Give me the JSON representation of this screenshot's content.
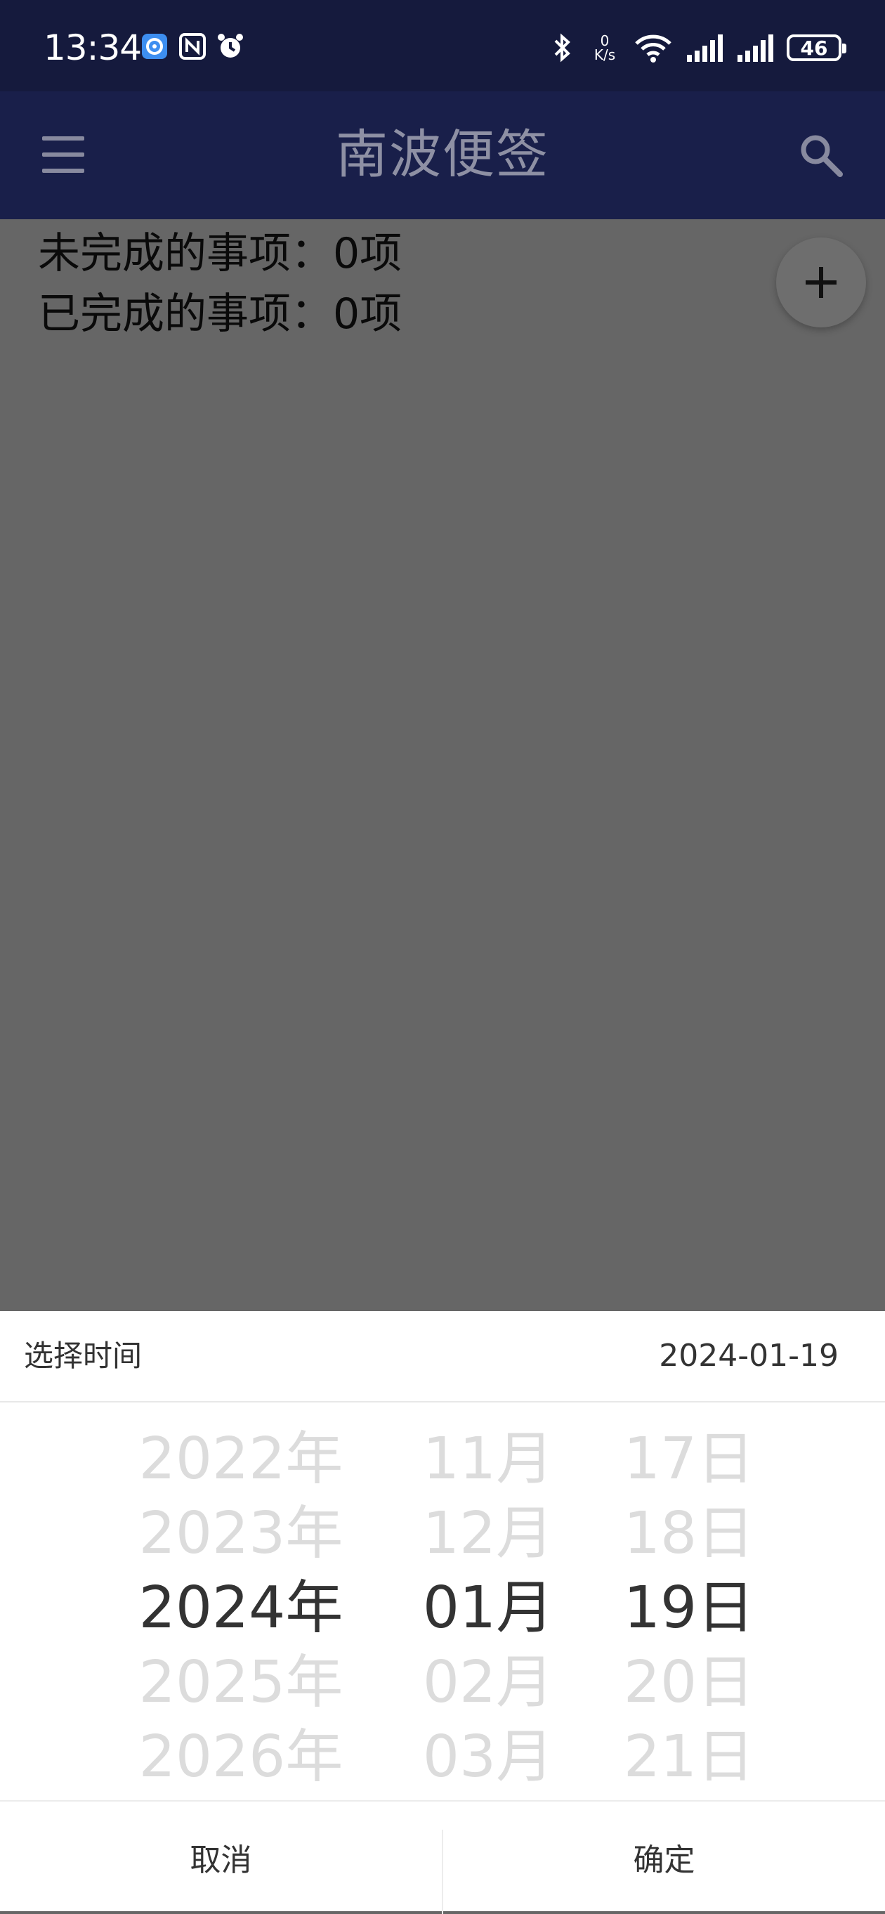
{
  "status_bar": {
    "time": "13:34",
    "left_icons": [
      "media-icon",
      "nfc-icon",
      "alarm-icon"
    ],
    "net_speed_value": "0",
    "net_speed_unit": "K/s",
    "battery": "46"
  },
  "app_bar": {
    "title": "南波便签"
  },
  "summary": {
    "incomplete": "未完成的事项：0项",
    "completed": "已完成的事项：0项"
  },
  "picker": {
    "title": "选择时间",
    "current_date": "2024-01-19",
    "years": [
      "2022年",
      "2023年",
      "2024年",
      "2025年",
      "2026年"
    ],
    "months": [
      "11月",
      "12月",
      "01月",
      "02月",
      "03月"
    ],
    "days": [
      "17日",
      "18日",
      "19日",
      "20日",
      "21日"
    ],
    "selected_index": 2,
    "cancel_label": "取消",
    "confirm_label": "确定"
  },
  "colors": {
    "status_bar": "#151a3d",
    "app_bar_dimmed": "#191f4a",
    "scrim_background": "#666666",
    "sheet_background": "#ffffff"
  }
}
